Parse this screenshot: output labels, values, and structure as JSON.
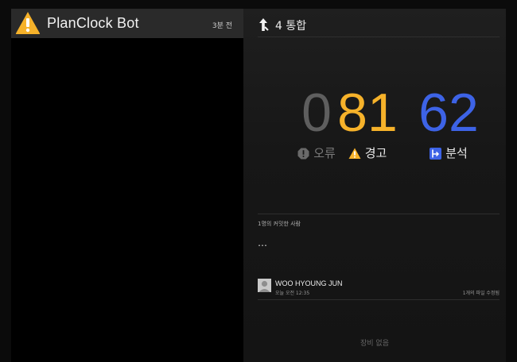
{
  "bot": {
    "name": "PlanClock Bot",
    "time_ago": "3분 전"
  },
  "integration": {
    "label": "4 통합"
  },
  "stats": {
    "errors": {
      "value": "0",
      "label": "오류",
      "color": "#5e5e5e"
    },
    "warnings": {
      "value": "81",
      "label": "경고",
      "color": "#f6b22a"
    },
    "analysis": {
      "value": "62",
      "label": "분석",
      "color": "#3d63e6"
    }
  },
  "committers": {
    "label": "1명의 커밋한 사람",
    "placeholder": "…"
  },
  "commit": {
    "author": "WOO HYOUNG JUN",
    "time": "오늘 오전 12:35",
    "files": "1개의 파일 수정됨"
  },
  "devices": {
    "empty_text": "장비 없음"
  }
}
